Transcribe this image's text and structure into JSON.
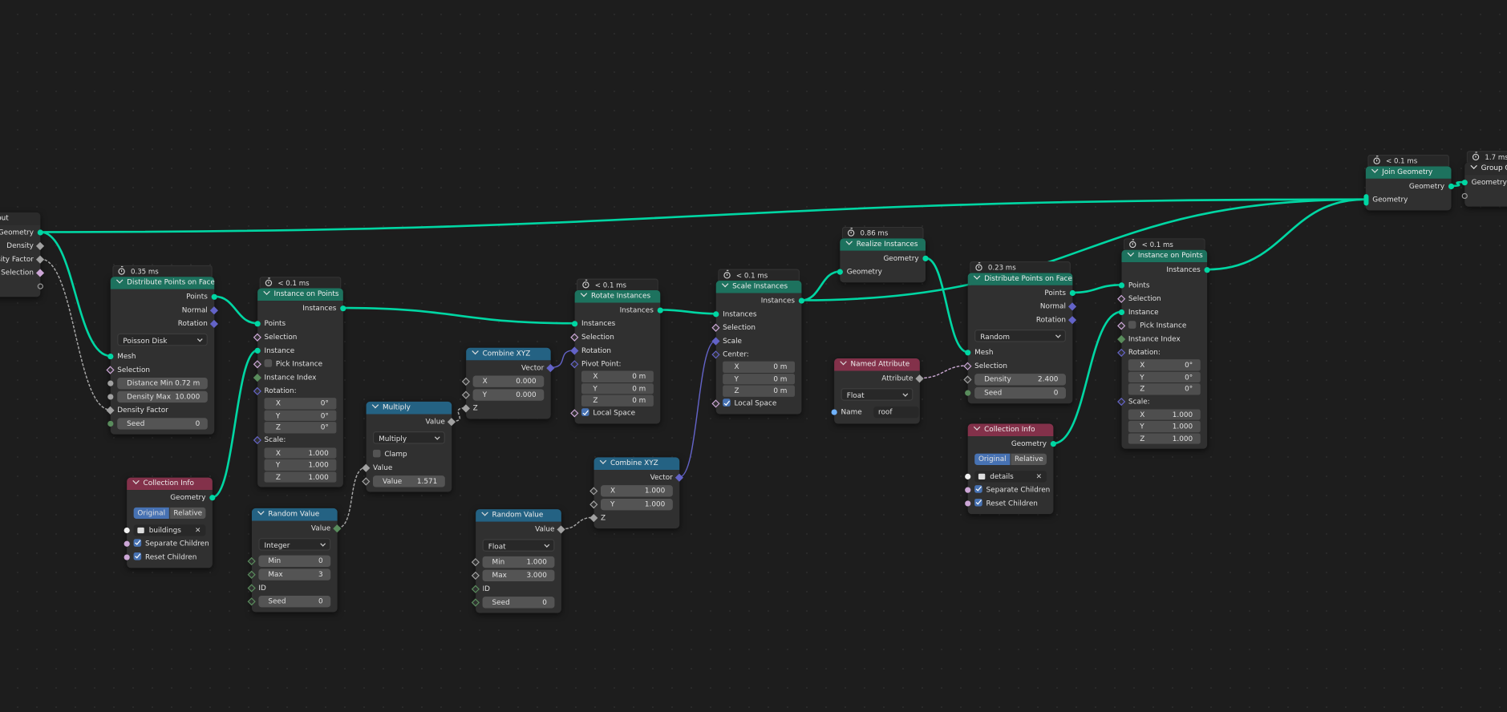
{
  "editor": "Geometry Node Editor",
  "socket_colors": {
    "geometry": "#00d6a3",
    "vector": "#6363c7",
    "float": "#a1a1a1",
    "int": "#598c5c",
    "bool": "#cca6d6",
    "string": "#70b2ff",
    "empty": "#999999"
  },
  "header_colors": {
    "geometry": "#1d725e",
    "input": "#83314a",
    "converter": "#246283",
    "group": "#2b2b2b"
  },
  "nodes": [
    {
      "id": "gi",
      "title": "Group Input",
      "kind": "group",
      "rows": [
        {
          "t": "out",
          "label": "Geometry",
          "s": "geometry:c"
        },
        {
          "t": "out",
          "label": "Density",
          "s": "float:d"
        },
        {
          "t": "out",
          "label": "Density Factor",
          "s": "float:d"
        },
        {
          "t": "out",
          "label": "Selection",
          "s": "bool:d"
        },
        {
          "t": "out",
          "label": "",
          "s": "empty:e"
        }
      ]
    },
    {
      "id": "dpf1",
      "title": "Distribute Points on Faces",
      "kind": "geometry",
      "timing": "0.35 ms",
      "rows": [
        {
          "t": "out",
          "label": "Points",
          "s": "geometry:c"
        },
        {
          "t": "out",
          "label": "Normal",
          "s": "vector:d"
        },
        {
          "t": "out",
          "label": "Rotation",
          "s": "vector:d"
        },
        {
          "t": "dd",
          "label": "Poisson Disk"
        },
        {
          "t": "in",
          "label": "Mesh",
          "s": "geometry:c"
        },
        {
          "t": "in",
          "label": "Selection",
          "s": "bool:h"
        },
        {
          "t": "field",
          "label": "Distance Min",
          "value": "0.72 m",
          "s": "float:c"
        },
        {
          "t": "field",
          "label": "Density Max",
          "value": "10.000",
          "s": "float:c"
        },
        {
          "t": "in",
          "label": "Density Factor",
          "s": "float:d"
        },
        {
          "t": "field",
          "label": "Seed",
          "value": "0",
          "s": "int:c"
        }
      ]
    },
    {
      "id": "iop1",
      "title": "Instance on Points",
      "kind": "geometry",
      "timing": "< 0.1 ms",
      "rows": [
        {
          "t": "out",
          "label": "Instances",
          "s": "geometry:c"
        },
        {
          "t": "spacer"
        },
        {
          "t": "in",
          "label": "Points",
          "s": "geometry:c"
        },
        {
          "t": "in",
          "label": "Selection",
          "s": "bool:h"
        },
        {
          "t": "in",
          "label": "Instance",
          "s": "geometry:c"
        },
        {
          "t": "check",
          "label": "Pick Instance",
          "checked": false,
          "s": "bool:h"
        },
        {
          "t": "in",
          "label": "Instance Index",
          "s": "int:d"
        },
        {
          "t": "in",
          "label": "Rotation:",
          "s": "vector:h"
        },
        {
          "t": "vec",
          "label": "X",
          "value": "0°"
        },
        {
          "t": "vec",
          "label": "Y",
          "value": "0°"
        },
        {
          "t": "vec",
          "label": "Z",
          "value": "0°"
        },
        {
          "t": "in",
          "label": "Scale:",
          "s": "vector:h"
        },
        {
          "t": "vec",
          "label": "X",
          "value": "1.000"
        },
        {
          "t": "vec",
          "label": "Y",
          "value": "1.000"
        },
        {
          "t": "vec",
          "label": "Z",
          "value": "1.000"
        }
      ]
    },
    {
      "id": "ci1",
      "title": "Collection Info",
      "kind": "input",
      "rows": [
        {
          "t": "out",
          "label": "Geometry",
          "s": "geometry:c"
        },
        {
          "t": "toggle",
          "options": [
            "Original",
            "Relative"
          ],
          "active": 0
        },
        {
          "t": "coll",
          "label": "buildings",
          "s": "empty:wc"
        },
        {
          "t": "check",
          "label": "Separate Children",
          "checked": true,
          "s": "bool:c"
        },
        {
          "t": "check",
          "label": "Reset Children",
          "checked": true,
          "s": "bool:c"
        }
      ]
    },
    {
      "id": "rv1",
      "title": "Random Value",
      "kind": "converter",
      "rows": [
        {
          "t": "out",
          "label": "Value",
          "s": "int:d"
        },
        {
          "t": "dd",
          "label": "Integer"
        },
        {
          "t": "field",
          "label": "Min",
          "value": "0",
          "s": "int:h"
        },
        {
          "t": "field",
          "label": "Max",
          "value": "3",
          "s": "int:h"
        },
        {
          "t": "in",
          "label": "ID",
          "s": "int:h"
        },
        {
          "t": "field",
          "label": "Seed",
          "value": "0",
          "s": "int:h"
        }
      ]
    },
    {
      "id": "mul",
      "title": "Multiply",
      "kind": "converter",
      "rows": [
        {
          "t": "out",
          "label": "Value",
          "s": "float:d"
        },
        {
          "t": "dd",
          "label": "Multiply"
        },
        {
          "t": "check",
          "label": "Clamp",
          "checked": false
        },
        {
          "t": "in",
          "label": "Value",
          "s": "float:d"
        },
        {
          "t": "field",
          "label": "Value",
          "value": "1.571",
          "s": "float:h"
        }
      ]
    },
    {
      "id": "cx1",
      "title": "Combine XYZ",
      "kind": "converter",
      "rows": [
        {
          "t": "out",
          "label": "Vector",
          "s": "vector:d"
        },
        {
          "t": "field",
          "label": "X",
          "value": "0.000",
          "s": "float:h"
        },
        {
          "t": "field",
          "label": "Y",
          "value": "0.000",
          "s": "float:h"
        },
        {
          "t": "in",
          "label": "Z",
          "s": "float:d"
        }
      ]
    },
    {
      "id": "rot",
      "title": "Rotate Instances",
      "kind": "geometry",
      "timing": "< 0.1 ms",
      "rows": [
        {
          "t": "out",
          "label": "Instances",
          "s": "geometry:c"
        },
        {
          "t": "in",
          "label": "Instances",
          "s": "geometry:c"
        },
        {
          "t": "in",
          "label": "Selection",
          "s": "bool:h"
        },
        {
          "t": "in",
          "label": "Rotation",
          "s": "vector:d"
        },
        {
          "t": "in",
          "label": "Pivot Point:",
          "s": "vector:h"
        },
        {
          "t": "vec",
          "label": "X",
          "value": "0 m"
        },
        {
          "t": "vec",
          "label": "Y",
          "value": "0 m"
        },
        {
          "t": "vec",
          "label": "Z",
          "value": "0 m"
        },
        {
          "t": "check",
          "label": "Local Space",
          "checked": true,
          "s": "bool:h"
        }
      ]
    },
    {
      "id": "cx2",
      "title": "Combine XYZ",
      "kind": "converter",
      "rows": [
        {
          "t": "out",
          "label": "Vector",
          "s": "vector:d"
        },
        {
          "t": "field",
          "label": "X",
          "value": "1.000",
          "s": "float:h"
        },
        {
          "t": "field",
          "label": "Y",
          "value": "1.000",
          "s": "float:h"
        },
        {
          "t": "in",
          "label": "Z",
          "s": "float:d"
        }
      ]
    },
    {
      "id": "rv2",
      "title": "Random Value",
      "kind": "converter",
      "rows": [
        {
          "t": "out",
          "label": "Value",
          "s": "float:d"
        },
        {
          "t": "dd",
          "label": "Float"
        },
        {
          "t": "field",
          "label": "Min",
          "value": "1.000",
          "s": "float:h"
        },
        {
          "t": "field",
          "label": "Max",
          "value": "3.000",
          "s": "float:h"
        },
        {
          "t": "in",
          "label": "ID",
          "s": "int:h"
        },
        {
          "t": "field",
          "label": "Seed",
          "value": "0",
          "s": "int:h"
        }
      ]
    },
    {
      "id": "sc",
      "title": "Scale Instances",
      "kind": "geometry",
      "timing": "< 0.1 ms",
      "rows": [
        {
          "t": "out",
          "label": "Instances",
          "s": "geometry:c"
        },
        {
          "t": "in",
          "label": "Instances",
          "s": "geometry:c"
        },
        {
          "t": "in",
          "label": "Selection",
          "s": "bool:h"
        },
        {
          "t": "in",
          "label": "Scale",
          "s": "vector:d"
        },
        {
          "t": "in",
          "label": "Center:",
          "s": "vector:h"
        },
        {
          "t": "vec",
          "label": "X",
          "value": "0 m"
        },
        {
          "t": "vec",
          "label": "Y",
          "value": "0 m"
        },
        {
          "t": "vec",
          "label": "Z",
          "value": "0 m"
        },
        {
          "t": "check",
          "label": "Local Space",
          "checked": true,
          "s": "bool:h"
        }
      ]
    },
    {
      "id": "re",
      "title": "Realize Instances",
      "kind": "geometry",
      "timing": "0.86 ms",
      "rows": [
        {
          "t": "out",
          "label": "Geometry",
          "s": "geometry:c"
        },
        {
          "t": "in",
          "label": "Geometry",
          "s": "geometry:c"
        }
      ]
    },
    {
      "id": "na",
      "title": "Named Attribute",
      "kind": "input",
      "rows": [
        {
          "t": "out",
          "label": "Attribute",
          "s": "float:d"
        },
        {
          "t": "dd",
          "label": "Float"
        },
        {
          "t": "textin",
          "label": "Name",
          "value": "roof",
          "s": "string:c"
        }
      ]
    },
    {
      "id": "dpf2",
      "title": "Distribute Points on Faces",
      "kind": "geometry",
      "timing": "0.23 ms",
      "rows": [
        {
          "t": "out",
          "label": "Points",
          "s": "geometry:c"
        },
        {
          "t": "out",
          "label": "Normal",
          "s": "vector:d"
        },
        {
          "t": "out",
          "label": "Rotation",
          "s": "vector:d"
        },
        {
          "t": "dd",
          "label": "Random"
        },
        {
          "t": "in",
          "label": "Mesh",
          "s": "geometry:c"
        },
        {
          "t": "in",
          "label": "Selection",
          "s": "bool:h"
        },
        {
          "t": "field",
          "label": "Density",
          "value": "2.400",
          "s": "float:h"
        },
        {
          "t": "field",
          "label": "Seed",
          "value": "0",
          "s": "int:c"
        }
      ]
    },
    {
      "id": "ci2",
      "title": "Collection Info",
      "kind": "input",
      "rows": [
        {
          "t": "out",
          "label": "Geometry",
          "s": "geometry:c"
        },
        {
          "t": "toggle",
          "options": [
            "Original",
            "Relative"
          ],
          "active": 0
        },
        {
          "t": "coll",
          "label": "details",
          "s": "empty:wc"
        },
        {
          "t": "check",
          "label": "Separate Children",
          "checked": true,
          "s": "bool:c"
        },
        {
          "t": "check",
          "label": "Reset Children",
          "checked": true,
          "s": "bool:c"
        }
      ]
    },
    {
      "id": "iop2",
      "title": "Instance on Points",
      "kind": "geometry",
      "timing": "< 0.1 ms",
      "rows": [
        {
          "t": "out",
          "label": "Instances",
          "s": "geometry:c"
        },
        {
          "t": "spacer"
        },
        {
          "t": "in",
          "label": "Points",
          "s": "geometry:c"
        },
        {
          "t": "in",
          "label": "Selection",
          "s": "bool:h"
        },
        {
          "t": "in",
          "label": "Instance",
          "s": "geometry:c"
        },
        {
          "t": "check",
          "label": "Pick Instance",
          "checked": false,
          "s": "bool:h"
        },
        {
          "t": "in",
          "label": "Instance Index",
          "s": "int:d"
        },
        {
          "t": "in",
          "label": "Rotation:",
          "s": "vector:h"
        },
        {
          "t": "vec",
          "label": "X",
          "value": "0°"
        },
        {
          "t": "vec",
          "label": "Y",
          "value": "0°"
        },
        {
          "t": "vec",
          "label": "Z",
          "value": "0°"
        },
        {
          "t": "in",
          "label": "Scale:",
          "s": "vector:h"
        },
        {
          "t": "vec",
          "label": "X",
          "value": "1.000"
        },
        {
          "t": "vec",
          "label": "Y",
          "value": "1.000"
        },
        {
          "t": "vec",
          "label": "Z",
          "value": "1.000"
        }
      ]
    },
    {
      "id": "join",
      "title": "Join Geometry",
      "kind": "geometry",
      "timing": "< 0.1 ms",
      "rows": [
        {
          "t": "out",
          "label": "Geometry",
          "s": "geometry:c"
        },
        {
          "t": "in",
          "label": "Geometry",
          "s": "geometry:multi"
        }
      ]
    },
    {
      "id": "go",
      "title": "Group Output",
      "kind": "group",
      "timing": "1.7 ms",
      "rows": [
        {
          "t": "in",
          "label": "Geometry",
          "s": "geometry:c"
        },
        {
          "t": "in",
          "label": "",
          "s": "empty:e"
        }
      ]
    }
  ],
  "links": [
    {
      "from": "gi.0",
      "to": "join.1",
      "type": "geometry"
    },
    {
      "from": "gi.0",
      "to": "dpf1.4",
      "type": "geometry"
    },
    {
      "from": "gi.2",
      "to": "dpf1.8",
      "type": "float"
    },
    {
      "from": "dpf1.0",
      "to": "iop1.2",
      "type": "geometry"
    },
    {
      "from": "ci1.0",
      "to": "iop1.4",
      "type": "geometry"
    },
    {
      "from": "iop1.0",
      "to": "rot.1",
      "type": "geometry"
    },
    {
      "from": "cx1.0",
      "to": "rot.3",
      "type": "vector"
    },
    {
      "from": "mul.0",
      "to": "cx1.3",
      "type": "float"
    },
    {
      "from": "rv1.0",
      "to": "mul.3",
      "type": "float"
    },
    {
      "from": "rot.0",
      "to": "sc.1",
      "type": "geometry"
    },
    {
      "from": "cx2.0",
      "to": "sc.3",
      "type": "vector"
    },
    {
      "from": "rv2.0",
      "to": "cx2.3",
      "type": "float"
    },
    {
      "from": "sc.0",
      "to": "re.1",
      "type": "geometry"
    },
    {
      "from": "sc.0",
      "to": "join.1",
      "type": "geometry"
    },
    {
      "from": "re.0",
      "to": "dpf2.4",
      "type": "geometry"
    },
    {
      "from": "na.0",
      "to": "dpf2.5",
      "type": "bool"
    },
    {
      "from": "dpf2.0",
      "to": "iop2.2",
      "type": "geometry"
    },
    {
      "from": "ci2.0",
      "to": "iop2.4",
      "type": "geometry"
    },
    {
      "from": "iop2.0",
      "to": "join.1",
      "type": "geometry"
    },
    {
      "from": "join.0",
      "to": "go.0",
      "type": "geometry"
    }
  ]
}
